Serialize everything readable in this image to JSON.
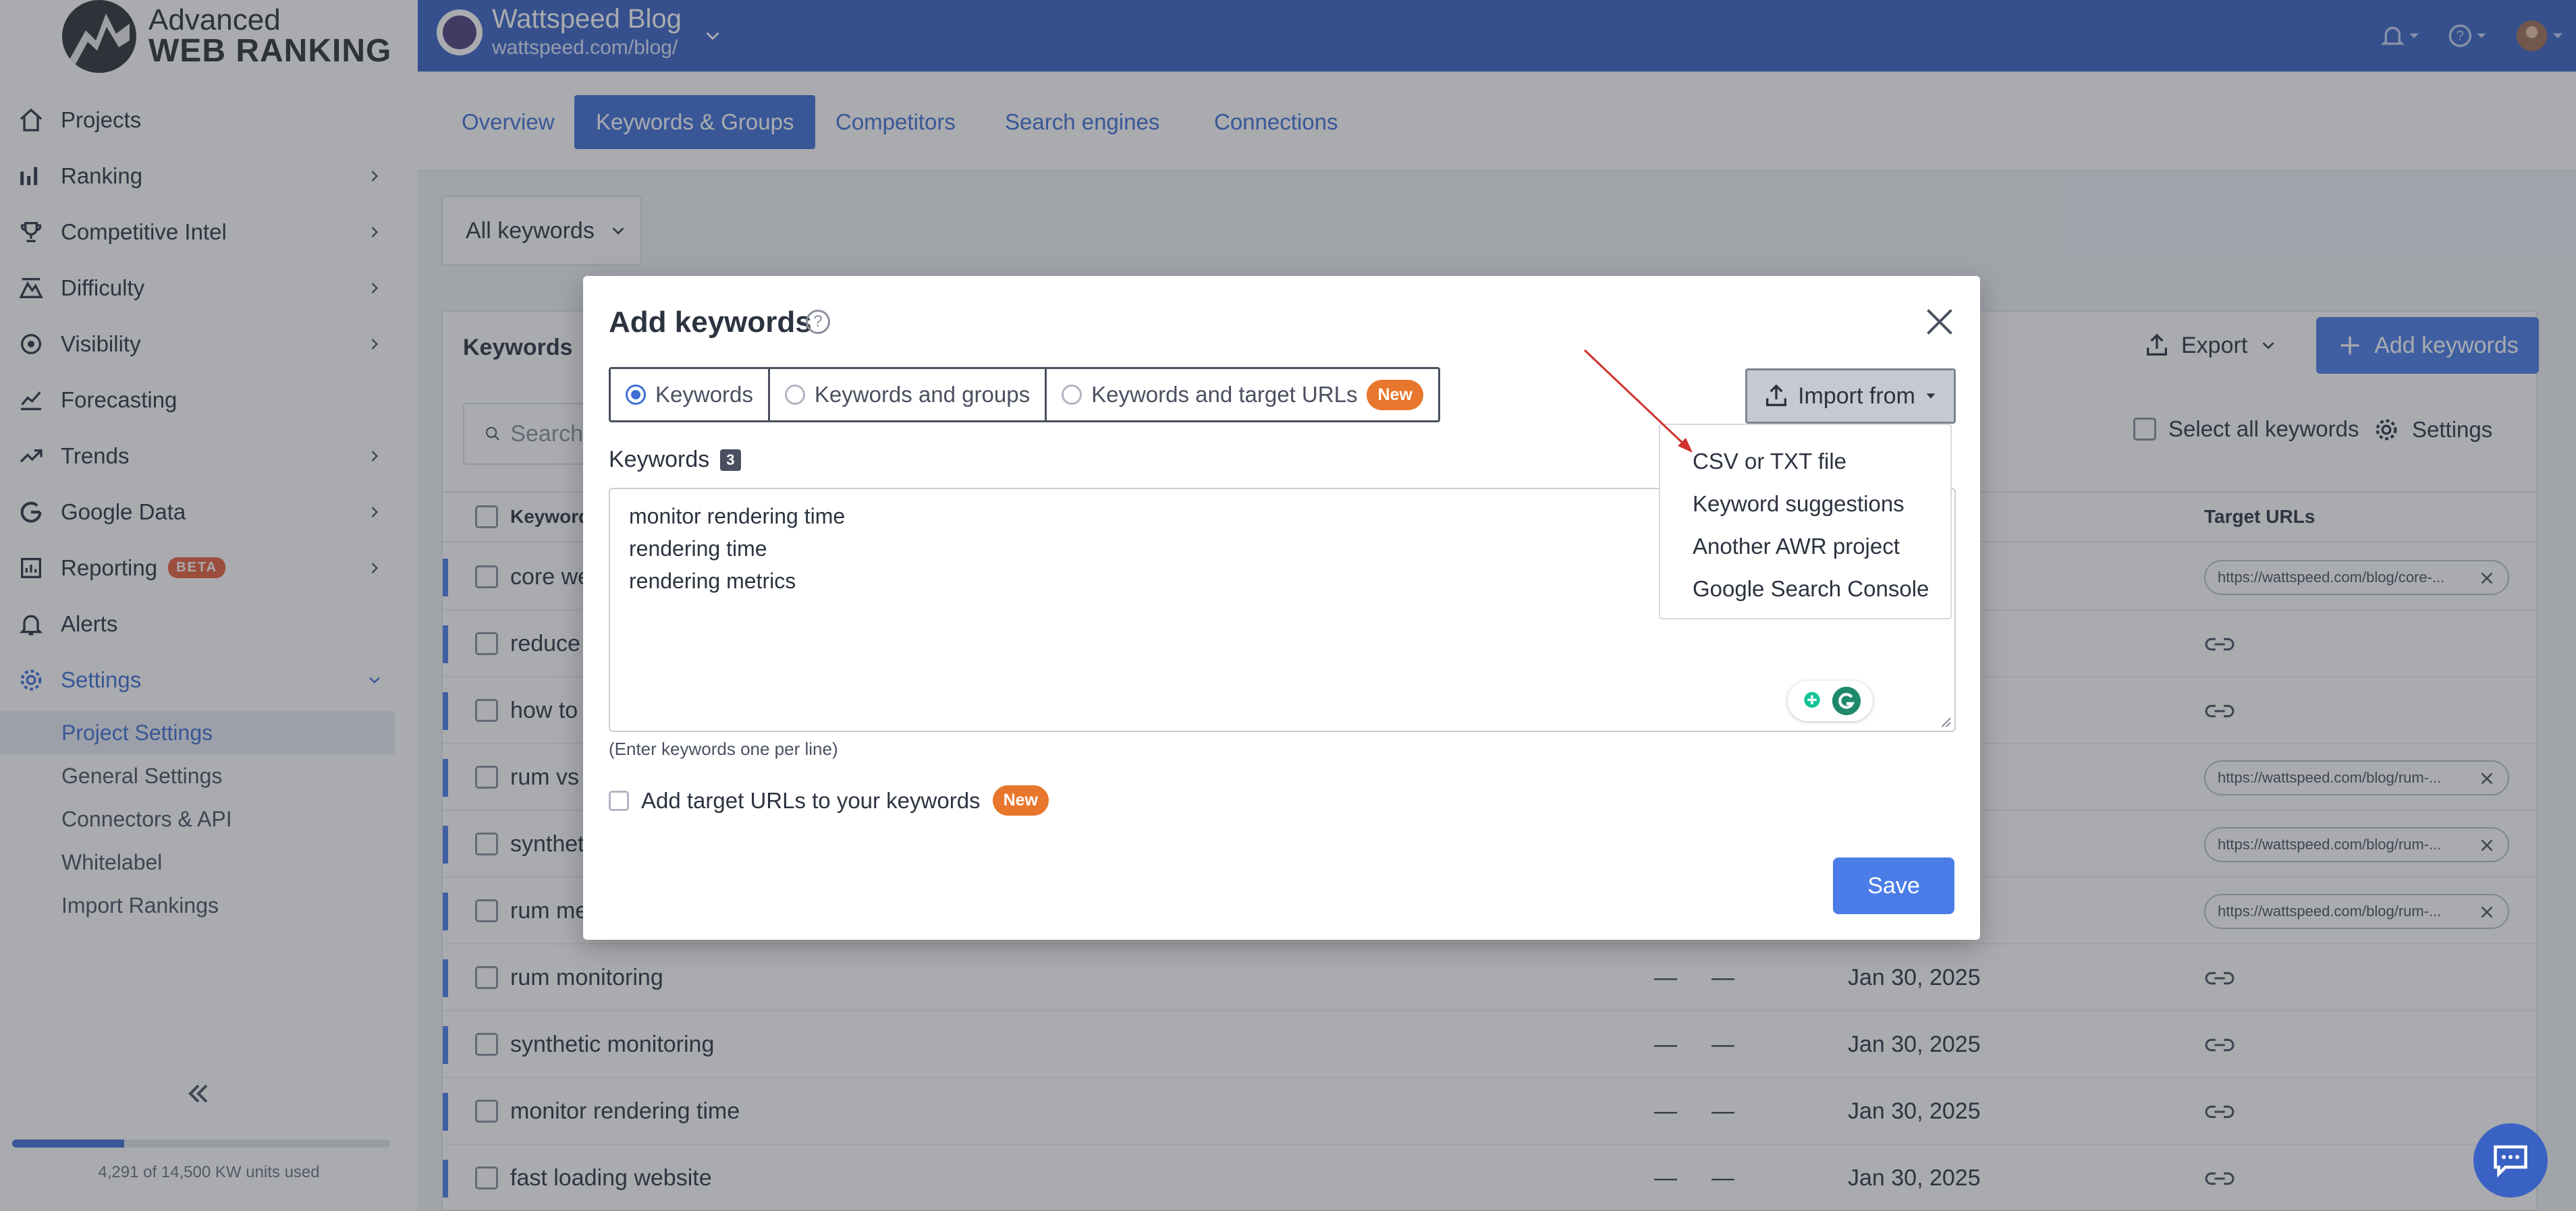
{
  "brand": {
    "line1": "Advanced",
    "line2": "WEB RANKING"
  },
  "sidebar": {
    "items": [
      {
        "label": "Projects",
        "icon": "home-icon"
      },
      {
        "label": "Ranking",
        "icon": "bar-chart-icon"
      },
      {
        "label": "Competitive Intel",
        "icon": "trophy-icon"
      },
      {
        "label": "Difficulty",
        "icon": "difficulty-icon"
      },
      {
        "label": "Visibility",
        "icon": "visibility-icon"
      },
      {
        "label": "Forecasting",
        "icon": "forecast-icon"
      },
      {
        "label": "Trends",
        "icon": "trend-icon"
      },
      {
        "label": "Google Data",
        "icon": "google-icon"
      },
      {
        "label": "Reporting",
        "icon": "report-icon",
        "badge": "BETA"
      },
      {
        "label": "Alerts",
        "icon": "bell-icon"
      },
      {
        "label": "Settings",
        "icon": "gear-icon"
      }
    ],
    "settings_sub": [
      "Project Settings",
      "General Settings",
      "Connectors & API",
      "Whitelabel",
      "Import Rankings"
    ],
    "usage_text": "4,291 of 14,500 KW units used",
    "usage_fraction": 0.296
  },
  "topbar": {
    "project_title": "Wattspeed Blog",
    "project_url": "wattspeed.com/blog/"
  },
  "tabs": [
    "Overview",
    "Keywords & Groups",
    "Competitors",
    "Search engines",
    "Connections"
  ],
  "filter": {
    "label": "All keywords"
  },
  "panel": {
    "title": "Keywords",
    "export_label": "Export",
    "add_label": "Add keywords",
    "search_placeholder": "Search",
    "select_all_label": "Select all keywords",
    "settings_label": "Settings",
    "col_keyword": "Keyword",
    "col_target": "Target URLs",
    "rows": [
      {
        "keyword": "core we",
        "url": "https://wattspeed.com/blog/core-..."
      },
      {
        "keyword": "reduce",
        "url": ""
      },
      {
        "keyword": "how to",
        "url": ""
      },
      {
        "keyword": "rum vs",
        "url": "https://wattspeed.com/blog/rum-..."
      },
      {
        "keyword": "synthet",
        "url": "https://wattspeed.com/blog/rum-..."
      },
      {
        "keyword": "rum me",
        "url": "https://wattspeed.com/blog/rum-..."
      },
      {
        "keyword": "rum monitoring",
        "d1": "—",
        "d2": "—",
        "date": "Jan 30, 2025"
      },
      {
        "keyword": "synthetic monitoring",
        "d1": "—",
        "d2": "—",
        "date": "Jan 30, 2025"
      },
      {
        "keyword": "monitor rendering time",
        "d1": "—",
        "d2": "—",
        "date": "Jan 30, 2025"
      },
      {
        "keyword": "fast loading website",
        "d1": "—",
        "d2": "—",
        "date": "Jan 30, 2025"
      }
    ]
  },
  "modal": {
    "title": "Add keywords",
    "help": "?",
    "options": [
      "Keywords",
      "Keywords and groups",
      "Keywords and target URLs"
    ],
    "new_badge": "New",
    "import_label": "Import from",
    "keywords_label": "Keywords",
    "keywords_count": "3",
    "keywords": [
      "monitor rendering time",
      "rendering time",
      "rendering metrics"
    ],
    "hint": "(Enter keywords one per line)",
    "target_label": "Add target URLs to your keywords",
    "save_label": "Save"
  },
  "import_menu": [
    "CSV or TXT file",
    "Keyword suggestions",
    "Another AWR project",
    "Google Search Console"
  ],
  "colors": {
    "primary": "#3f6fd6",
    "topbar": "#3a62c4",
    "new_badge": "#e8762c",
    "arrow": "#d0312d"
  }
}
